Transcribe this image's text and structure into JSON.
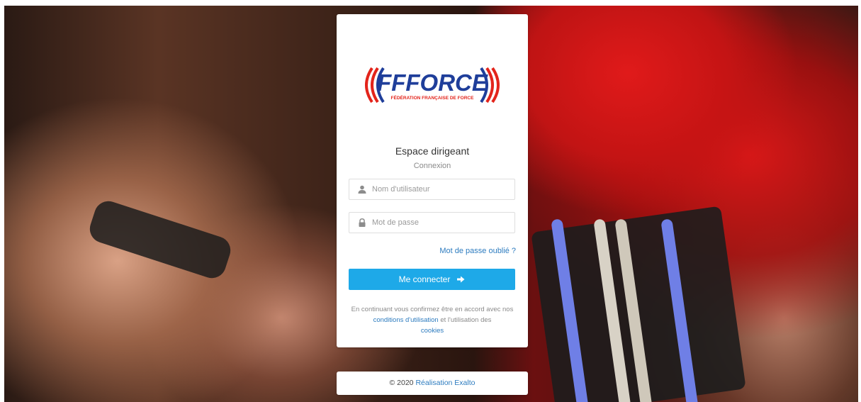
{
  "logo": {
    "main_text": "FFFORCE",
    "sub_text": "FÉDÉRATION FRANÇAISE DE FORCE",
    "colors": {
      "red": "#e3241b",
      "blue": "#1f3e9a"
    }
  },
  "card": {
    "title": "Espace dirigeant",
    "subtitle": "Connexion"
  },
  "form": {
    "username": {
      "placeholder": "Nom d'utilisateur",
      "value": ""
    },
    "password": {
      "placeholder": "Mot de passe",
      "value": ""
    },
    "forgot_label": "Mot de passe oublié ?",
    "login_label": "Me connecter",
    "login_color": "#1ea9e8"
  },
  "legal": {
    "prefix": "En continuant vous confirmez être en accord avec nos",
    "terms_link": "conditions d'utilisation",
    "middle": "et l'utilisation des",
    "cookies_link": "cookies"
  },
  "footer": {
    "copyright": "© 2020",
    "credit_link": "Réalisation Exalto"
  },
  "icons": {
    "user": "user-icon",
    "lock": "lock-icon",
    "arrow": "arrow-right-icon"
  }
}
